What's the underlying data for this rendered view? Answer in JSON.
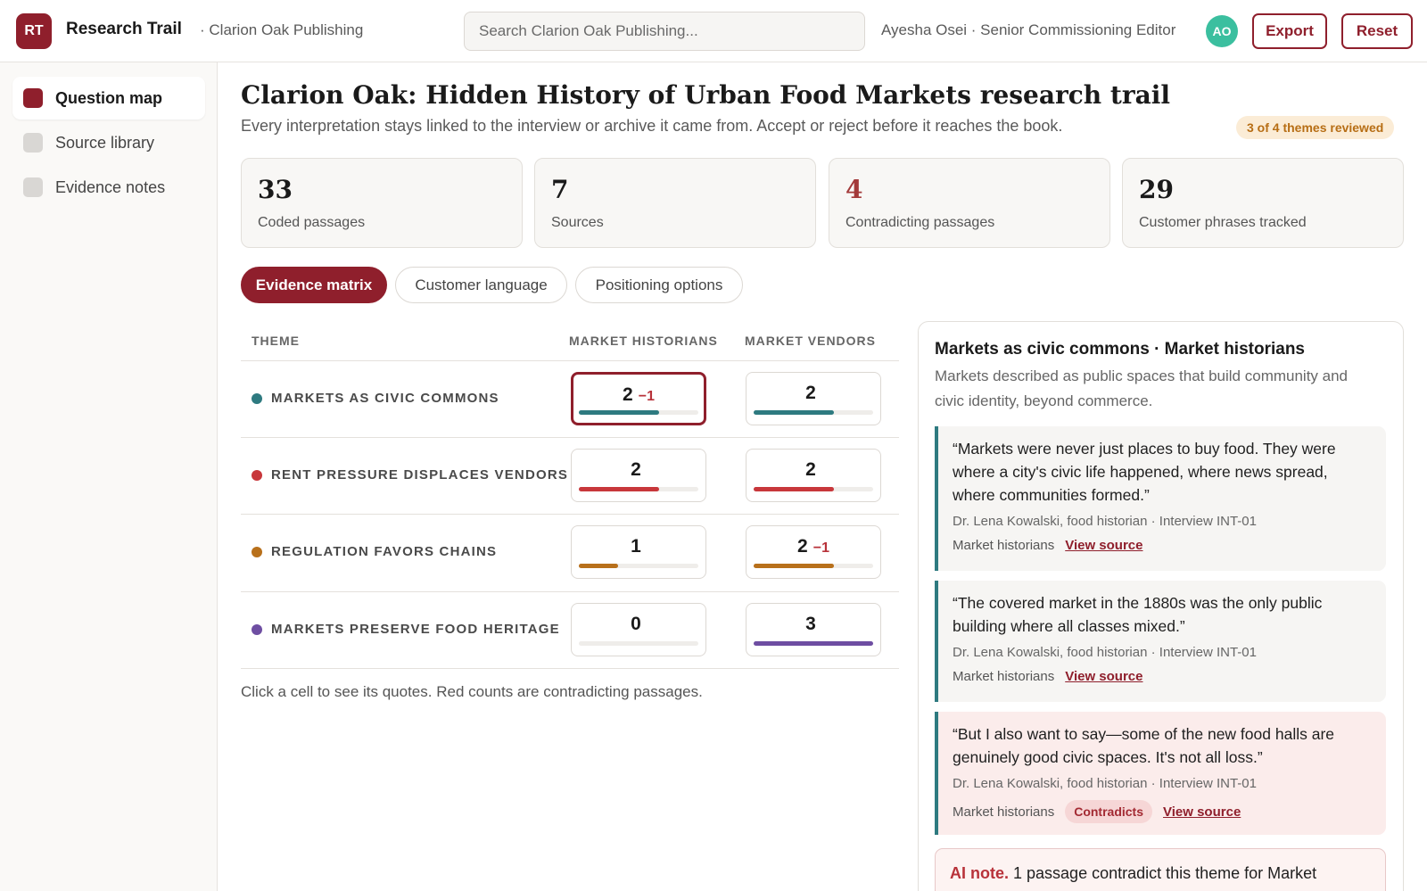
{
  "app": {
    "logo": "RT",
    "title": "Research Trail",
    "org": "· Clarion Oak Publishing"
  },
  "search": {
    "placeholder": "Search Clarion Oak Publishing..."
  },
  "user": {
    "name": "Ayesha Osei · Senior Commissioning Editor",
    "initials": "AO",
    "avatar_color": "#3bbf9f"
  },
  "header_buttons": {
    "export": "Export",
    "reset": "Reset"
  },
  "sidebar": {
    "items": [
      {
        "label": "Question map",
        "active": true
      },
      {
        "label": "Source library",
        "active": false
      },
      {
        "label": "Evidence notes",
        "active": false
      }
    ]
  },
  "page": {
    "title": "Clarion Oak: Hidden History of Urban Food Markets research trail",
    "subtitle": "Every interpretation stays linked to the interview or archive it came from. Accept or reject before it reaches the book.",
    "review_badge": "3 of 4 themes reviewed"
  },
  "stats": [
    {
      "value": "33",
      "label": "Coded passages"
    },
    {
      "value": "7",
      "label": "Sources"
    },
    {
      "value": "4",
      "label": "Contradicting passages",
      "highlight": true
    },
    {
      "value": "29",
      "label": "Customer phrases tracked"
    }
  ],
  "tabs": [
    {
      "label": "Evidence matrix",
      "active": true
    },
    {
      "label": "Customer language",
      "active": false
    },
    {
      "label": "Positioning options",
      "active": false
    }
  ],
  "matrix": {
    "headers": {
      "theme": "THEME",
      "col1": "MARKET HISTORIANS",
      "col2": "MARKET VENDORS"
    },
    "max_count": 3,
    "rows": [
      {
        "theme": "MARKETS AS CIVIC COMMONS",
        "color": "#2e7a80",
        "cells": [
          {
            "count": "2",
            "contra": "−1",
            "fraction": 0.67,
            "selected": true
          },
          {
            "count": "2",
            "contra": "",
            "fraction": 0.67,
            "selected": false
          }
        ]
      },
      {
        "theme": "RENT PRESSURE DISPLACES VENDORS",
        "color": "#c8373b",
        "cells": [
          {
            "count": "2",
            "contra": "",
            "fraction": 0.67,
            "selected": false
          },
          {
            "count": "2",
            "contra": "",
            "fraction": 0.67,
            "selected": false
          }
        ]
      },
      {
        "theme": "REGULATION FAVORS CHAINS",
        "color": "#b8701b",
        "cells": [
          {
            "count": "1",
            "contra": "",
            "fraction": 0.33,
            "selected": false
          },
          {
            "count": "2",
            "contra": "−1",
            "fraction": 0.67,
            "selected": false
          }
        ]
      },
      {
        "theme": "MARKETS PRESERVE FOOD HERITAGE",
        "color": "#6e4ea2",
        "cells": [
          {
            "count": "0",
            "contra": "",
            "fraction": 0,
            "selected": false
          },
          {
            "count": "3",
            "contra": "",
            "fraction": 1,
            "selected": false
          }
        ]
      }
    ],
    "hint": "Click a cell to see its quotes. Red counts are contradicting passages."
  },
  "detail": {
    "title": "Markets as civic commons · Market historians",
    "description": "Markets described as public spaces that build community and civic identity, beyond commerce.",
    "quotes": [
      {
        "text": "“Markets were never just places to buy food. They were where a city's civic life happened, where news spread, where communities formed.”",
        "cite": "Dr. Lena Kowalski, food historian · Interview INT-01",
        "group": "Market historians",
        "contradicts": "",
        "link": "View source"
      },
      {
        "text": "“The covered market in the 1880s was the only public building where all classes mixed.”",
        "cite": "Dr. Lena Kowalski, food historian · Interview INT-01",
        "group": "Market historians",
        "contradicts": "",
        "link": "View source"
      },
      {
        "text": "“But I also want to say—some of the new food halls are genuinely good civic spaces. It's not all loss.”",
        "cite": "Dr. Lena Kowalski, food historian · Interview INT-01",
        "group": "Market historians",
        "contradicts": "Contradicts",
        "link": "View source"
      }
    ],
    "ai_note": {
      "label": "AI note.",
      "text": "1 passage contradict this theme for Market"
    }
  }
}
